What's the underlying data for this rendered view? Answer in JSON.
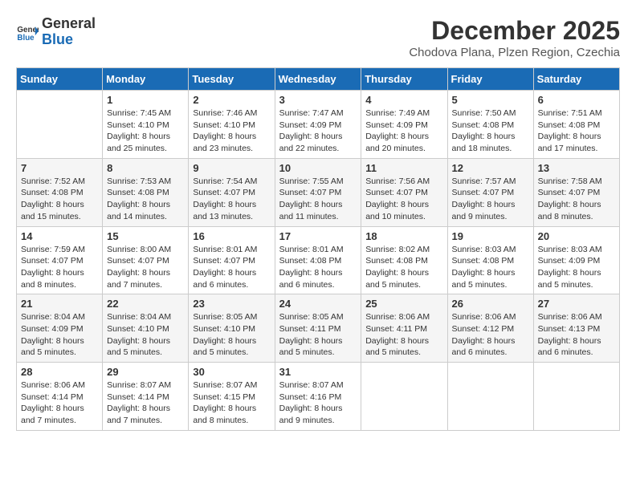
{
  "header": {
    "logo_line1": "General",
    "logo_line2": "Blue",
    "month": "December 2025",
    "location": "Chodova Plana, Plzen Region, Czechia"
  },
  "days_of_week": [
    "Sunday",
    "Monday",
    "Tuesday",
    "Wednesday",
    "Thursday",
    "Friday",
    "Saturday"
  ],
  "weeks": [
    [
      {
        "day": "",
        "sunrise": "",
        "sunset": "",
        "daylight": ""
      },
      {
        "day": "1",
        "sunrise": "7:45 AM",
        "sunset": "4:10 PM",
        "daylight": "8 hours and 25 minutes."
      },
      {
        "day": "2",
        "sunrise": "7:46 AM",
        "sunset": "4:10 PM",
        "daylight": "8 hours and 23 minutes."
      },
      {
        "day": "3",
        "sunrise": "7:47 AM",
        "sunset": "4:09 PM",
        "daylight": "8 hours and 22 minutes."
      },
      {
        "day": "4",
        "sunrise": "7:49 AM",
        "sunset": "4:09 PM",
        "daylight": "8 hours and 20 minutes."
      },
      {
        "day": "5",
        "sunrise": "7:50 AM",
        "sunset": "4:08 PM",
        "daylight": "8 hours and 18 minutes."
      },
      {
        "day": "6",
        "sunrise": "7:51 AM",
        "sunset": "4:08 PM",
        "daylight": "8 hours and 17 minutes."
      }
    ],
    [
      {
        "day": "7",
        "sunrise": "7:52 AM",
        "sunset": "4:08 PM",
        "daylight": "8 hours and 15 minutes."
      },
      {
        "day": "8",
        "sunrise": "7:53 AM",
        "sunset": "4:08 PM",
        "daylight": "8 hours and 14 minutes."
      },
      {
        "day": "9",
        "sunrise": "7:54 AM",
        "sunset": "4:07 PM",
        "daylight": "8 hours and 13 minutes."
      },
      {
        "day": "10",
        "sunrise": "7:55 AM",
        "sunset": "4:07 PM",
        "daylight": "8 hours and 11 minutes."
      },
      {
        "day": "11",
        "sunrise": "7:56 AM",
        "sunset": "4:07 PM",
        "daylight": "8 hours and 10 minutes."
      },
      {
        "day": "12",
        "sunrise": "7:57 AM",
        "sunset": "4:07 PM",
        "daylight": "8 hours and 9 minutes."
      },
      {
        "day": "13",
        "sunrise": "7:58 AM",
        "sunset": "4:07 PM",
        "daylight": "8 hours and 8 minutes."
      }
    ],
    [
      {
        "day": "14",
        "sunrise": "7:59 AM",
        "sunset": "4:07 PM",
        "daylight": "8 hours and 8 minutes."
      },
      {
        "day": "15",
        "sunrise": "8:00 AM",
        "sunset": "4:07 PM",
        "daylight": "8 hours and 7 minutes."
      },
      {
        "day": "16",
        "sunrise": "8:01 AM",
        "sunset": "4:07 PM",
        "daylight": "8 hours and 6 minutes."
      },
      {
        "day": "17",
        "sunrise": "8:01 AM",
        "sunset": "4:08 PM",
        "daylight": "8 hours and 6 minutes."
      },
      {
        "day": "18",
        "sunrise": "8:02 AM",
        "sunset": "4:08 PM",
        "daylight": "8 hours and 5 minutes."
      },
      {
        "day": "19",
        "sunrise": "8:03 AM",
        "sunset": "4:08 PM",
        "daylight": "8 hours and 5 minutes."
      },
      {
        "day": "20",
        "sunrise": "8:03 AM",
        "sunset": "4:09 PM",
        "daylight": "8 hours and 5 minutes."
      }
    ],
    [
      {
        "day": "21",
        "sunrise": "8:04 AM",
        "sunset": "4:09 PM",
        "daylight": "8 hours and 5 minutes."
      },
      {
        "day": "22",
        "sunrise": "8:04 AM",
        "sunset": "4:10 PM",
        "daylight": "8 hours and 5 minutes."
      },
      {
        "day": "23",
        "sunrise": "8:05 AM",
        "sunset": "4:10 PM",
        "daylight": "8 hours and 5 minutes."
      },
      {
        "day": "24",
        "sunrise": "8:05 AM",
        "sunset": "4:11 PM",
        "daylight": "8 hours and 5 minutes."
      },
      {
        "day": "25",
        "sunrise": "8:06 AM",
        "sunset": "4:11 PM",
        "daylight": "8 hours and 5 minutes."
      },
      {
        "day": "26",
        "sunrise": "8:06 AM",
        "sunset": "4:12 PM",
        "daylight": "8 hours and 6 minutes."
      },
      {
        "day": "27",
        "sunrise": "8:06 AM",
        "sunset": "4:13 PM",
        "daylight": "8 hours and 6 minutes."
      }
    ],
    [
      {
        "day": "28",
        "sunrise": "8:06 AM",
        "sunset": "4:14 PM",
        "daylight": "8 hours and 7 minutes."
      },
      {
        "day": "29",
        "sunrise": "8:07 AM",
        "sunset": "4:14 PM",
        "daylight": "8 hours and 7 minutes."
      },
      {
        "day": "30",
        "sunrise": "8:07 AM",
        "sunset": "4:15 PM",
        "daylight": "8 hours and 8 minutes."
      },
      {
        "day": "31",
        "sunrise": "8:07 AM",
        "sunset": "4:16 PM",
        "daylight": "8 hours and 9 minutes."
      },
      {
        "day": "",
        "sunrise": "",
        "sunset": "",
        "daylight": ""
      },
      {
        "day": "",
        "sunrise": "",
        "sunset": "",
        "daylight": ""
      },
      {
        "day": "",
        "sunrise": "",
        "sunset": "",
        "daylight": ""
      }
    ]
  ]
}
